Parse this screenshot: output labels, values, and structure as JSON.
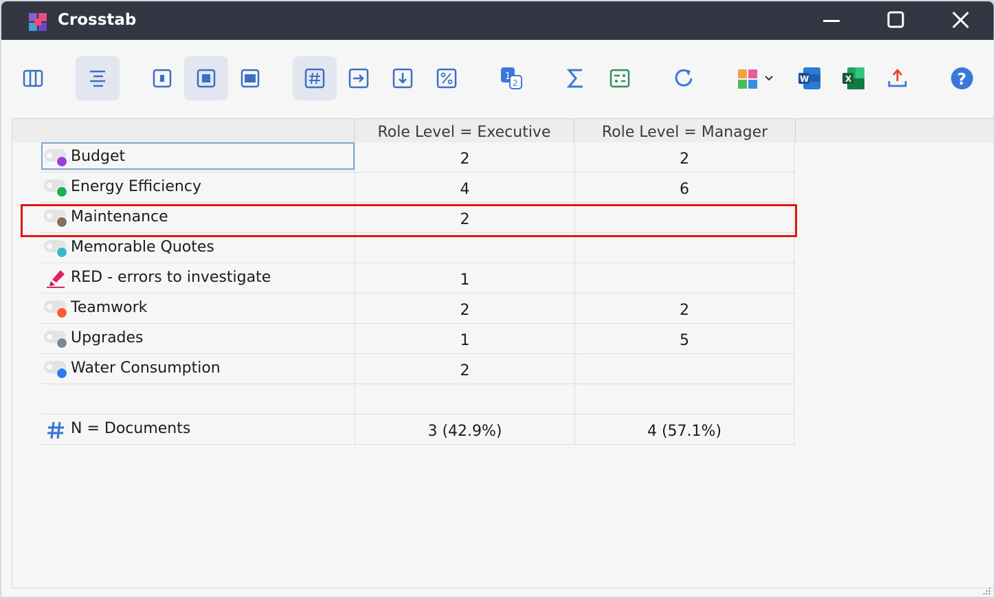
{
  "window": {
    "title": "Crosstab"
  },
  "toolbar": {
    "icons": [
      "columns-view-icon",
      "align-lines-icon",
      "layout-small-icon",
      "layout-medium-icon",
      "layout-wide-icon",
      "hash-count-icon",
      "arrow-right-icon",
      "arrow-down-icon",
      "percent-icon",
      "numbering-icon",
      "sum-icon",
      "toggle-list-icon",
      "refresh-icon",
      "puzzle-icon",
      "word-export-icon",
      "excel-export-icon",
      "upload-export-icon",
      "help-icon"
    ]
  },
  "table": {
    "columns": [
      "Role Level = Executive",
      "Role Level = Manager"
    ],
    "rows": [
      {
        "label": "Budget",
        "icon": "code-dot-icon",
        "color": "#9b3fd9",
        "values": [
          "2",
          "2"
        ]
      },
      {
        "label": "Energy Efficiency",
        "icon": "code-dot-icon",
        "color": "#22b04f",
        "values": [
          "4",
          "6"
        ]
      },
      {
        "label": "Maintenance",
        "icon": "code-dot-icon",
        "color": "#8a6e5e",
        "values": [
          "2",
          ""
        ]
      },
      {
        "label": "Memorable Quotes",
        "icon": "code-dot-icon",
        "color": "#3bb9cc",
        "values": [
          "",
          ""
        ]
      },
      {
        "label": "RED - errors to investigate",
        "icon": "highlighter-icon",
        "color": "#e0245e",
        "values": [
          "1",
          ""
        ]
      },
      {
        "label": "Teamwork",
        "icon": "code-dot-icon",
        "color": "#f5622d",
        "values": [
          "2",
          "2"
        ]
      },
      {
        "label": "Upgrades",
        "icon": "code-dot-icon",
        "color": "#7a8a94",
        "values": [
          "1",
          "5"
        ]
      },
      {
        "label": "Water Consumption",
        "icon": "code-dot-icon",
        "color": "#2b7de9",
        "values": [
          "2",
          ""
        ]
      }
    ],
    "total": {
      "label": "N = Documents",
      "icon": "hash-icon",
      "values": [
        "3 (42.9%)",
        "4 (57.1%)"
      ]
    }
  },
  "colors": {
    "accent": "#3a78d8",
    "highlight": "#e01616",
    "titlebar": "#323743"
  }
}
